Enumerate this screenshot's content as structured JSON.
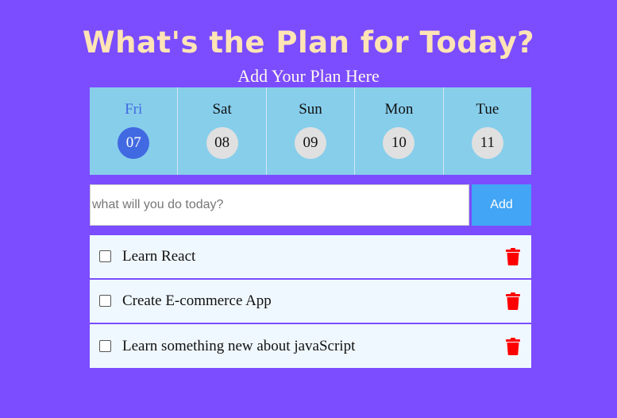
{
  "header": {
    "title": "What's the Plan for Today?",
    "subtitle": "Add Your Plan Here"
  },
  "calendar": {
    "days": [
      {
        "name": "Fri",
        "date": "07",
        "active": true
      },
      {
        "name": "Sat",
        "date": "08",
        "active": false
      },
      {
        "name": "Sun",
        "date": "09",
        "active": false
      },
      {
        "name": "Mon",
        "date": "10",
        "active": false
      },
      {
        "name": "Tue",
        "date": "11",
        "active": false
      }
    ]
  },
  "form": {
    "placeholder": "what will you do today?",
    "value": "",
    "add_label": "Add"
  },
  "tasks": [
    {
      "text": "Learn React",
      "checked": false
    },
    {
      "text": "Create E-commerce App",
      "checked": false
    },
    {
      "text": "Learn something new about javaScript",
      "checked": false
    }
  ],
  "colors": {
    "background": "#7b4dff",
    "title": "#ffe4b5",
    "calendar_bg": "#87ceeb",
    "active_day": "#4169e1",
    "add_button": "#42a5f5",
    "delete_icon": "#ff0000"
  },
  "icons": {
    "delete": "trash-icon",
    "checkbox": "checkbox"
  }
}
